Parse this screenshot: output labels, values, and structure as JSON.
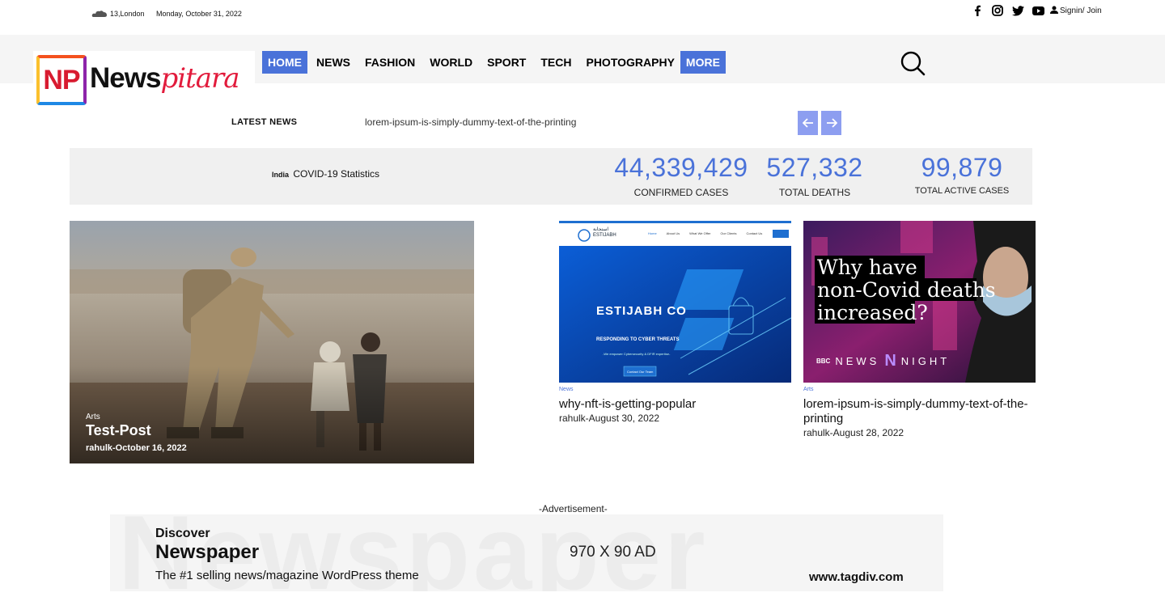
{
  "topbar": {
    "weather": "13,London",
    "date": "Monday, October 31, 2022",
    "socials": [
      "facebook-icon",
      "instagram-icon",
      "twitter-icon",
      "youtube-icon"
    ],
    "signin": "Signin/ Join"
  },
  "logo": {
    "badge": "NP",
    "name_part1": "News",
    "name_part2": "pitara"
  },
  "menu": {
    "items": [
      {
        "label": "HOME",
        "active": true
      },
      {
        "label": "NEWS",
        "active": false
      },
      {
        "label": "FASHION",
        "active": false
      },
      {
        "label": "WORLD",
        "active": false
      },
      {
        "label": "SPORT",
        "active": false
      },
      {
        "label": "TECH",
        "active": false
      },
      {
        "label": "PHOTOGRAPHY",
        "active": false
      },
      {
        "label": "MORE",
        "active": true
      }
    ]
  },
  "ticker": {
    "label": "LATEST NEWS",
    "item": "lorem-ipsum-is-simply-dummy-text-of-the-printing"
  },
  "covid": {
    "country": "India",
    "title": "COVID-19 Statistics",
    "stats": [
      {
        "value": "44,339,429",
        "label": "CONFIRMED CASES"
      },
      {
        "value": "527,332",
        "label": "TOTAL DEATHS"
      },
      {
        "value": "99,879",
        "label": "TOTAL ACTIVE CASES"
      }
    ]
  },
  "featured": {
    "category": "Arts",
    "title": "Test-Post",
    "meta": "rahulk-October 16, 2022"
  },
  "cards": [
    {
      "category": "News",
      "title": "why-nft-is-getting-popular",
      "meta": "rahulk-August 30, 2022",
      "thumb_brand": "استجابة ESTIJABH",
      "thumb_headline": "ESTIJABH CO",
      "thumb_sub": "RESPONDING TO CYBER THREATS",
      "thumb_small": "-We empower Cybersecurity & DFIR expertise-",
      "thumb_button": "Contact Our Team",
      "thumb_nav": [
        "Home",
        "About Us",
        "What We Offer",
        "Our Clients",
        "Contact Us"
      ]
    },
    {
      "category": "Arts",
      "title": "lorem-ipsum-is-simply-dummy-text-of-the-printing",
      "meta": "rahulk-August 28, 2022",
      "thumb_line1": "Why have",
      "thumb_line2": "non-Covid deaths",
      "thumb_line3": "increased?",
      "thumb_logo1": "BBC",
      "thumb_logo2": "NEWS",
      "thumb_logo3": "NIGHT"
    }
  ],
  "ad": {
    "label": "-Advertisement-",
    "bg_word": "Newspaper",
    "discover": "Discover",
    "product": "Newspaper",
    "tagline": "The #1 selling news/magazine WordPress theme",
    "size": "970 X 90 AD",
    "site": "www.tagdiv.com"
  }
}
